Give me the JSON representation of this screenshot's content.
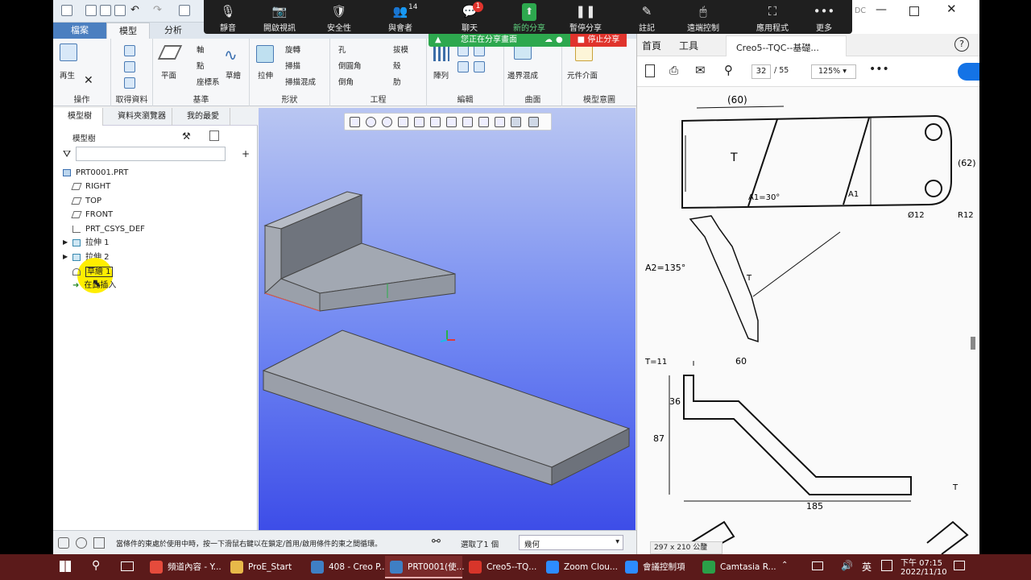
{
  "creo": {
    "tabs": [
      "檔案",
      "模型",
      "分析"
    ],
    "ribbon": {
      "groups": [
        "操作",
        "取得資料",
        "基準",
        "形狀",
        "工程",
        "編輯",
        "曲面",
        "模型意圖"
      ],
      "operations_item": "再生",
      "datum_items": [
        "軸",
        "點",
        "座標系"
      ],
      "datum_plane": "平面",
      "datum_sketch": "草繪",
      "shape_items": [
        "旋轉",
        "掃描",
        "掃描混成"
      ],
      "shape_extrude": "拉伸",
      "engineering_items": [
        "孔",
        "倒圓角",
        "倒角",
        "拔模",
        "殼",
        "肋"
      ],
      "edit_pattern": "陣列",
      "surface_boundary": "邊界混成",
      "model_intent_item": "元件介面"
    },
    "tree": {
      "tabs": [
        "模型樹",
        "資料夾瀏覽器",
        "我的最愛"
      ],
      "header": "模型樹",
      "root": "PRT0001.PRT",
      "nodes": [
        "RIGHT",
        "TOP",
        "FRONT",
        "PRT_CSYS_DEF",
        "拉伸 1",
        "拉伸 2",
        "草繪 1",
        "在此插入"
      ]
    },
    "status": {
      "message": "當條件的東處於使用中時，按一下滑鼠右鍵以在鎖定/首用/啟用條件的東之間循環。",
      "selected": "選取了1 個",
      "filter": "幾何"
    }
  },
  "zoom": {
    "controls": [
      {
        "label": "靜音",
        "icon": "microphone-icon",
        "glyph": "🎙"
      },
      {
        "label": "開啟視訊",
        "icon": "video-off-icon",
        "glyph": "📷"
      },
      {
        "label": "安全性",
        "icon": "shield-icon",
        "glyph": "🛡"
      },
      {
        "label": "與會者",
        "icon": "participants-icon",
        "glyph": "👥",
        "count": "14"
      },
      {
        "label": "聊天",
        "icon": "chat-icon",
        "glyph": "💬",
        "badge": "1"
      },
      {
        "label": "新的分享",
        "icon": "share-screen-icon",
        "glyph": "⬆"
      },
      {
        "label": "暫停分享",
        "icon": "pause-icon",
        "glyph": "❚❚"
      },
      {
        "label": "註記",
        "icon": "annotate-icon",
        "glyph": "✎"
      },
      {
        "label": "遠端控制",
        "icon": "mouse-icon",
        "glyph": "🖱"
      },
      {
        "label": "應用程式",
        "icon": "apps-icon",
        "glyph": "⛶"
      },
      {
        "label": "更多",
        "icon": "more-icon",
        "glyph": "•••"
      }
    ],
    "sharing_text": "您正在分享畫面",
    "stop_share": "停止分享"
  },
  "pdf": {
    "title_fragment": "DC",
    "nav_tabs": [
      "首頁",
      "工具"
    ],
    "doc_tab": "Creo5--TQC--基礎...",
    "page_current": "32",
    "page_total": "/ 55",
    "zoom": "125%",
    "page_size": "297 x 210 公釐",
    "drawing_labels": [
      "(60)",
      "(62)",
      "A1=30°",
      "A1",
      "T",
      "Ø12",
      "R12",
      "A2=135°",
      "T",
      "T=11",
      "60",
      "36",
      "87",
      "185",
      "T"
    ]
  },
  "taskbar": {
    "items": [
      {
        "label": "頻道內容 - Y...",
        "color": "#e54b3c"
      },
      {
        "label": "ProE_Start",
        "color": "#e8b949"
      },
      {
        "label": "408 - Creo P...",
        "color": "#3f7fc4"
      },
      {
        "label": "PRT0001(使...",
        "color": "#3f7fc4"
      },
      {
        "label": "Creo5--TQ...",
        "color": "#d8352a"
      },
      {
        "label": "Zoom Clou...",
        "color": "#2d8cff"
      },
      {
        "label": "會議控制項",
        "color": "#2d8cff"
      },
      {
        "label": "Camtasia R...",
        "color": "#2aa048"
      }
    ],
    "ime": "英",
    "time": "下午 07:15",
    "date": "2022/11/10"
  }
}
